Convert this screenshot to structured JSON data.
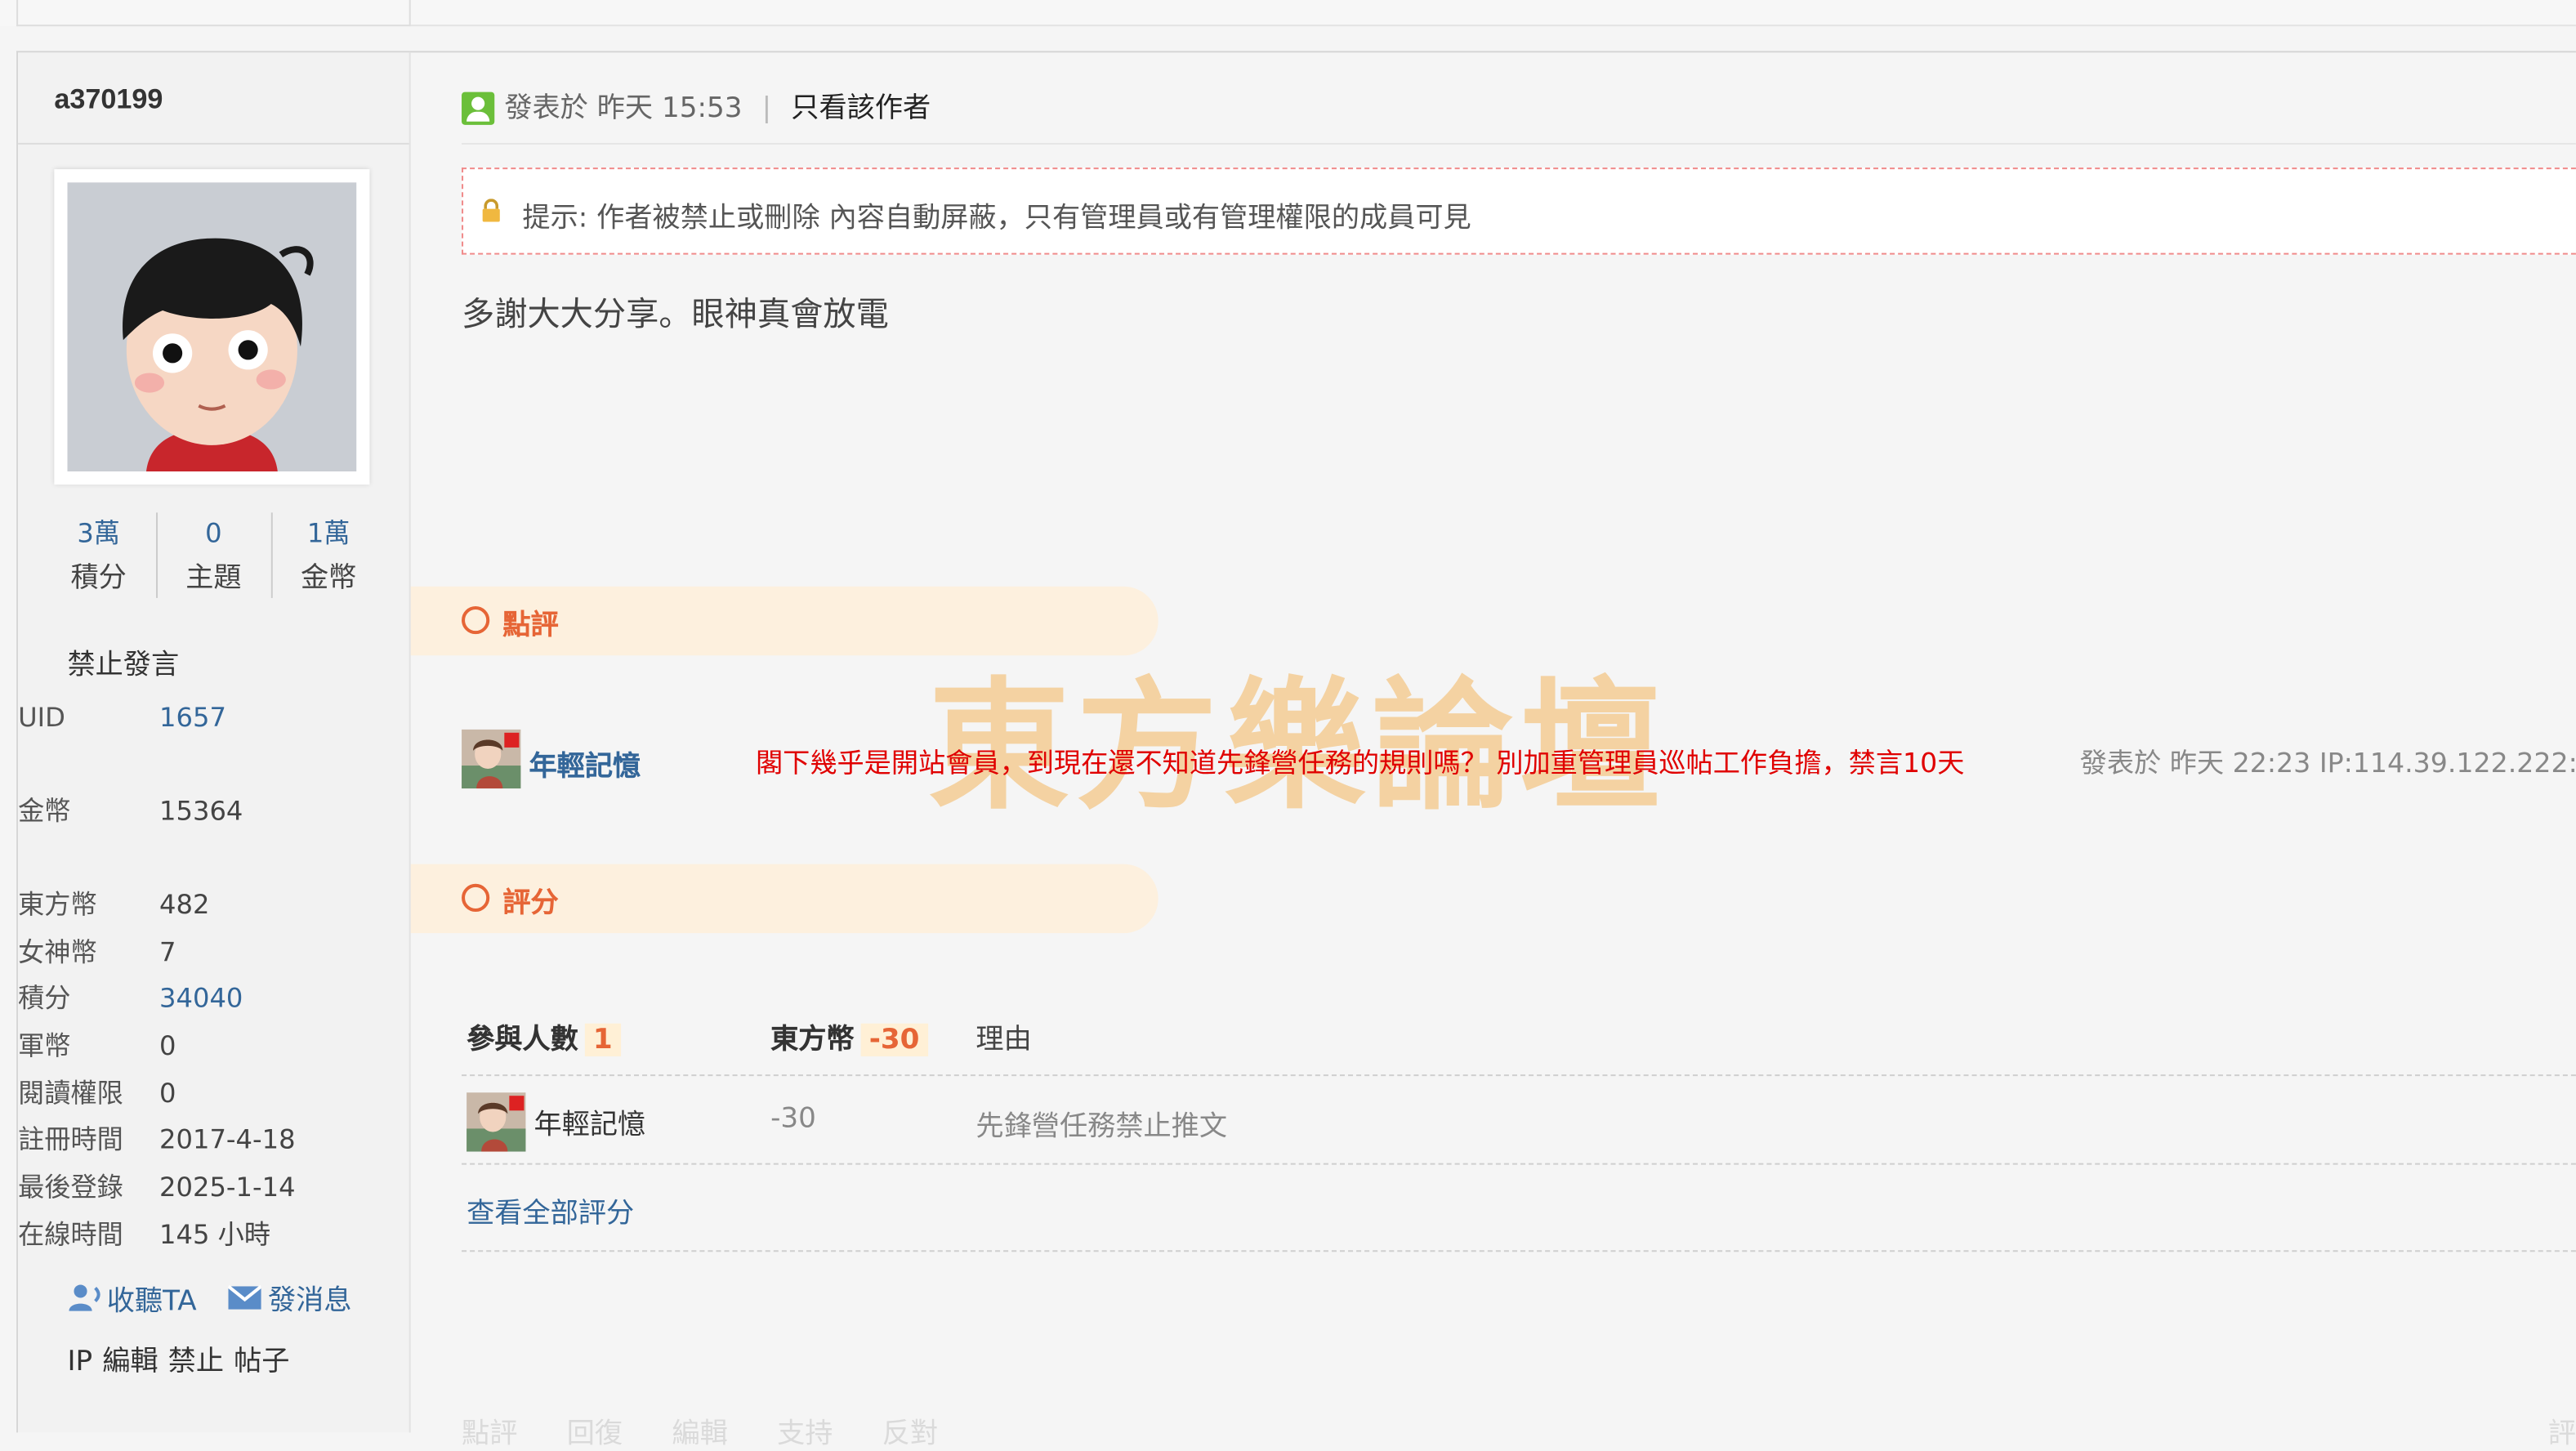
{
  "sidebar": {
    "username": "a370199",
    "stats": [
      {
        "value": "3萬",
        "label": "積分"
      },
      {
        "value": "0",
        "label": "主題"
      },
      {
        "value": "1萬",
        "label": "金幣"
      }
    ],
    "status": "禁止發言",
    "info": [
      {
        "key": "UID",
        "value": "1657",
        "link": true
      },
      {
        "key": "金幣",
        "value": "15364",
        "link": false
      },
      {
        "key": "東方幣",
        "value": "482",
        "link": false
      },
      {
        "key": "女神幣",
        "value": "7",
        "link": false
      },
      {
        "key": "積分",
        "value": "34040",
        "link": true
      },
      {
        "key": "軍幣",
        "value": "0",
        "link": false
      },
      {
        "key": "閱讀權限",
        "value": "0",
        "link": false
      },
      {
        "key": "註冊時間",
        "value": "2017-4-18",
        "link": false
      },
      {
        "key": "最後登錄",
        "value": "2025-1-14",
        "link": false
      },
      {
        "key": "在線時間",
        "value": "145 小時",
        "link": false
      }
    ],
    "follow_label": "收聽TA",
    "message_label": "發消息",
    "admin_links": [
      "IP",
      "編輯",
      "禁止",
      "帖子"
    ]
  },
  "post": {
    "posted_label": "發表於",
    "posted_time": "昨天 15:53",
    "only_author": "只看該作者",
    "notice": "提示: 作者被禁止或刪除 內容自動屏蔽，只有管理員或有管理權限的成員可見",
    "body": "多謝大大分享。眼神真會放電"
  },
  "comments_section": {
    "title": "點評",
    "items": [
      {
        "user": "年輕記憶",
        "text": "閣下幾乎是開站會員，到現在還不知道先鋒營任務的規則嗎？ 別加重管理員巡帖工作負擔，禁言10天",
        "meta": "發表於 昨天 22:23 IP:114.39.122.222:"
      }
    ]
  },
  "watermark": "東方樂論壇",
  "rating_section": {
    "title": "評分",
    "participants_label": "參與人數",
    "participants_count": "1",
    "currency_label": "東方幣",
    "currency_total": "-30",
    "reason_label": "理由",
    "rows": [
      {
        "user": "年輕記憶",
        "value": "-30",
        "reason": "先鋒營任務禁止推文"
      }
    ],
    "view_all": "查看全部評分"
  },
  "footer": {
    "actions": [
      "點評",
      "回復",
      "編輯",
      "支持",
      "反對"
    ],
    "right": "評"
  },
  "colors": {
    "link": "#336699",
    "accent": "#e66536",
    "warning_text": "#e00000",
    "tab_bg": "#fdf0de"
  }
}
